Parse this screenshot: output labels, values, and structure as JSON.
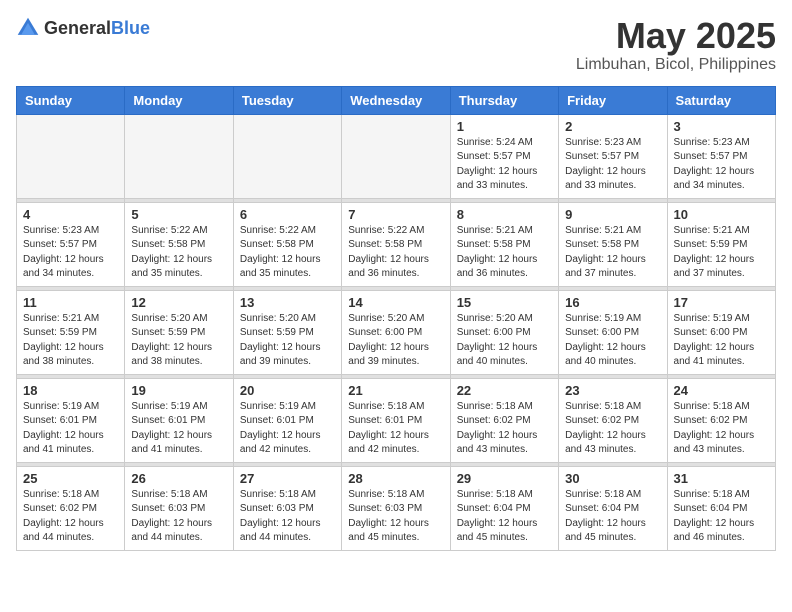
{
  "header": {
    "logo_general": "General",
    "logo_blue": "Blue",
    "month": "May 2025",
    "location": "Limbuhan, Bicol, Philippines"
  },
  "days_of_week": [
    "Sunday",
    "Monday",
    "Tuesday",
    "Wednesday",
    "Thursday",
    "Friday",
    "Saturday"
  ],
  "weeks": [
    [
      {
        "day": "",
        "info": ""
      },
      {
        "day": "",
        "info": ""
      },
      {
        "day": "",
        "info": ""
      },
      {
        "day": "",
        "info": ""
      },
      {
        "day": "1",
        "info": "Sunrise: 5:24 AM\nSunset: 5:57 PM\nDaylight: 12 hours\nand 33 minutes."
      },
      {
        "day": "2",
        "info": "Sunrise: 5:23 AM\nSunset: 5:57 PM\nDaylight: 12 hours\nand 33 minutes."
      },
      {
        "day": "3",
        "info": "Sunrise: 5:23 AM\nSunset: 5:57 PM\nDaylight: 12 hours\nand 34 minutes."
      }
    ],
    [
      {
        "day": "4",
        "info": "Sunrise: 5:23 AM\nSunset: 5:57 PM\nDaylight: 12 hours\nand 34 minutes."
      },
      {
        "day": "5",
        "info": "Sunrise: 5:22 AM\nSunset: 5:58 PM\nDaylight: 12 hours\nand 35 minutes."
      },
      {
        "day": "6",
        "info": "Sunrise: 5:22 AM\nSunset: 5:58 PM\nDaylight: 12 hours\nand 35 minutes."
      },
      {
        "day": "7",
        "info": "Sunrise: 5:22 AM\nSunset: 5:58 PM\nDaylight: 12 hours\nand 36 minutes."
      },
      {
        "day": "8",
        "info": "Sunrise: 5:21 AM\nSunset: 5:58 PM\nDaylight: 12 hours\nand 36 minutes."
      },
      {
        "day": "9",
        "info": "Sunrise: 5:21 AM\nSunset: 5:58 PM\nDaylight: 12 hours\nand 37 minutes."
      },
      {
        "day": "10",
        "info": "Sunrise: 5:21 AM\nSunset: 5:59 PM\nDaylight: 12 hours\nand 37 minutes."
      }
    ],
    [
      {
        "day": "11",
        "info": "Sunrise: 5:21 AM\nSunset: 5:59 PM\nDaylight: 12 hours\nand 38 minutes."
      },
      {
        "day": "12",
        "info": "Sunrise: 5:20 AM\nSunset: 5:59 PM\nDaylight: 12 hours\nand 38 minutes."
      },
      {
        "day": "13",
        "info": "Sunrise: 5:20 AM\nSunset: 5:59 PM\nDaylight: 12 hours\nand 39 minutes."
      },
      {
        "day": "14",
        "info": "Sunrise: 5:20 AM\nSunset: 6:00 PM\nDaylight: 12 hours\nand 39 minutes."
      },
      {
        "day": "15",
        "info": "Sunrise: 5:20 AM\nSunset: 6:00 PM\nDaylight: 12 hours\nand 40 minutes."
      },
      {
        "day": "16",
        "info": "Sunrise: 5:19 AM\nSunset: 6:00 PM\nDaylight: 12 hours\nand 40 minutes."
      },
      {
        "day": "17",
        "info": "Sunrise: 5:19 AM\nSunset: 6:00 PM\nDaylight: 12 hours\nand 41 minutes."
      }
    ],
    [
      {
        "day": "18",
        "info": "Sunrise: 5:19 AM\nSunset: 6:01 PM\nDaylight: 12 hours\nand 41 minutes."
      },
      {
        "day": "19",
        "info": "Sunrise: 5:19 AM\nSunset: 6:01 PM\nDaylight: 12 hours\nand 41 minutes."
      },
      {
        "day": "20",
        "info": "Sunrise: 5:19 AM\nSunset: 6:01 PM\nDaylight: 12 hours\nand 42 minutes."
      },
      {
        "day": "21",
        "info": "Sunrise: 5:18 AM\nSunset: 6:01 PM\nDaylight: 12 hours\nand 42 minutes."
      },
      {
        "day": "22",
        "info": "Sunrise: 5:18 AM\nSunset: 6:02 PM\nDaylight: 12 hours\nand 43 minutes."
      },
      {
        "day": "23",
        "info": "Sunrise: 5:18 AM\nSunset: 6:02 PM\nDaylight: 12 hours\nand 43 minutes."
      },
      {
        "day": "24",
        "info": "Sunrise: 5:18 AM\nSunset: 6:02 PM\nDaylight: 12 hours\nand 43 minutes."
      }
    ],
    [
      {
        "day": "25",
        "info": "Sunrise: 5:18 AM\nSunset: 6:02 PM\nDaylight: 12 hours\nand 44 minutes."
      },
      {
        "day": "26",
        "info": "Sunrise: 5:18 AM\nSunset: 6:03 PM\nDaylight: 12 hours\nand 44 minutes."
      },
      {
        "day": "27",
        "info": "Sunrise: 5:18 AM\nSunset: 6:03 PM\nDaylight: 12 hours\nand 44 minutes."
      },
      {
        "day": "28",
        "info": "Sunrise: 5:18 AM\nSunset: 6:03 PM\nDaylight: 12 hours\nand 45 minutes."
      },
      {
        "day": "29",
        "info": "Sunrise: 5:18 AM\nSunset: 6:04 PM\nDaylight: 12 hours\nand 45 minutes."
      },
      {
        "day": "30",
        "info": "Sunrise: 5:18 AM\nSunset: 6:04 PM\nDaylight: 12 hours\nand 45 minutes."
      },
      {
        "day": "31",
        "info": "Sunrise: 5:18 AM\nSunset: 6:04 PM\nDaylight: 12 hours\nand 46 minutes."
      }
    ]
  ]
}
